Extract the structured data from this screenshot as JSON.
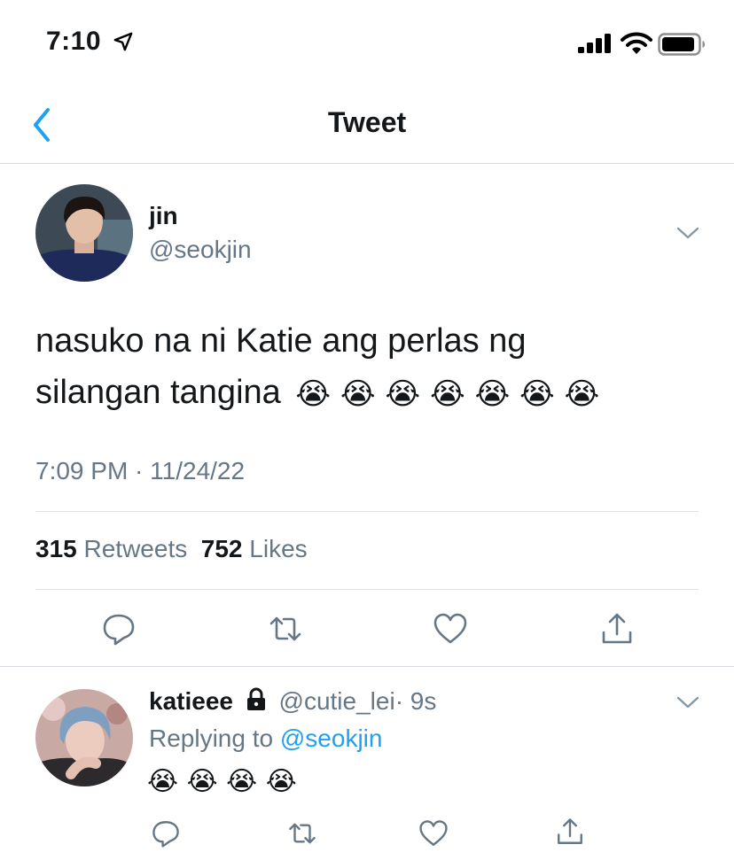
{
  "status_bar": {
    "time": "7:10"
  },
  "nav": {
    "title": "Tweet"
  },
  "tweet": {
    "name": "jin",
    "handle": "@seokjin",
    "text_line1": "nasuko na ni Katie ang perlas ng",
    "text_line2": "silangan tangina",
    "emoji": "😭 😭 😭 😭 😭 😭 😭",
    "timestamp": "7:09 PM · 11/24/22",
    "retweets_count": "315",
    "retweets_label": "Retweets",
    "likes_count": "752",
    "likes_label": "Likes"
  },
  "reply": {
    "name": "katieee",
    "handle": "@cutie_lei",
    "time": "· 9s",
    "replying_prefix": "Replying to",
    "replying_to": "@seokjin",
    "emoji": "😭 😭 😭 😭"
  },
  "colors": {
    "accent": "#1da1f2",
    "muted": "#657786",
    "text": "#14171a",
    "divider": "#d6dbdf"
  },
  "icons": [
    "location-arrow-icon",
    "signal-icon",
    "wifi-icon",
    "battery-icon",
    "back-chevron-icon",
    "chevron-down-icon",
    "reply-icon",
    "retweet-icon",
    "like-icon",
    "share-icon",
    "lock-icon"
  ]
}
